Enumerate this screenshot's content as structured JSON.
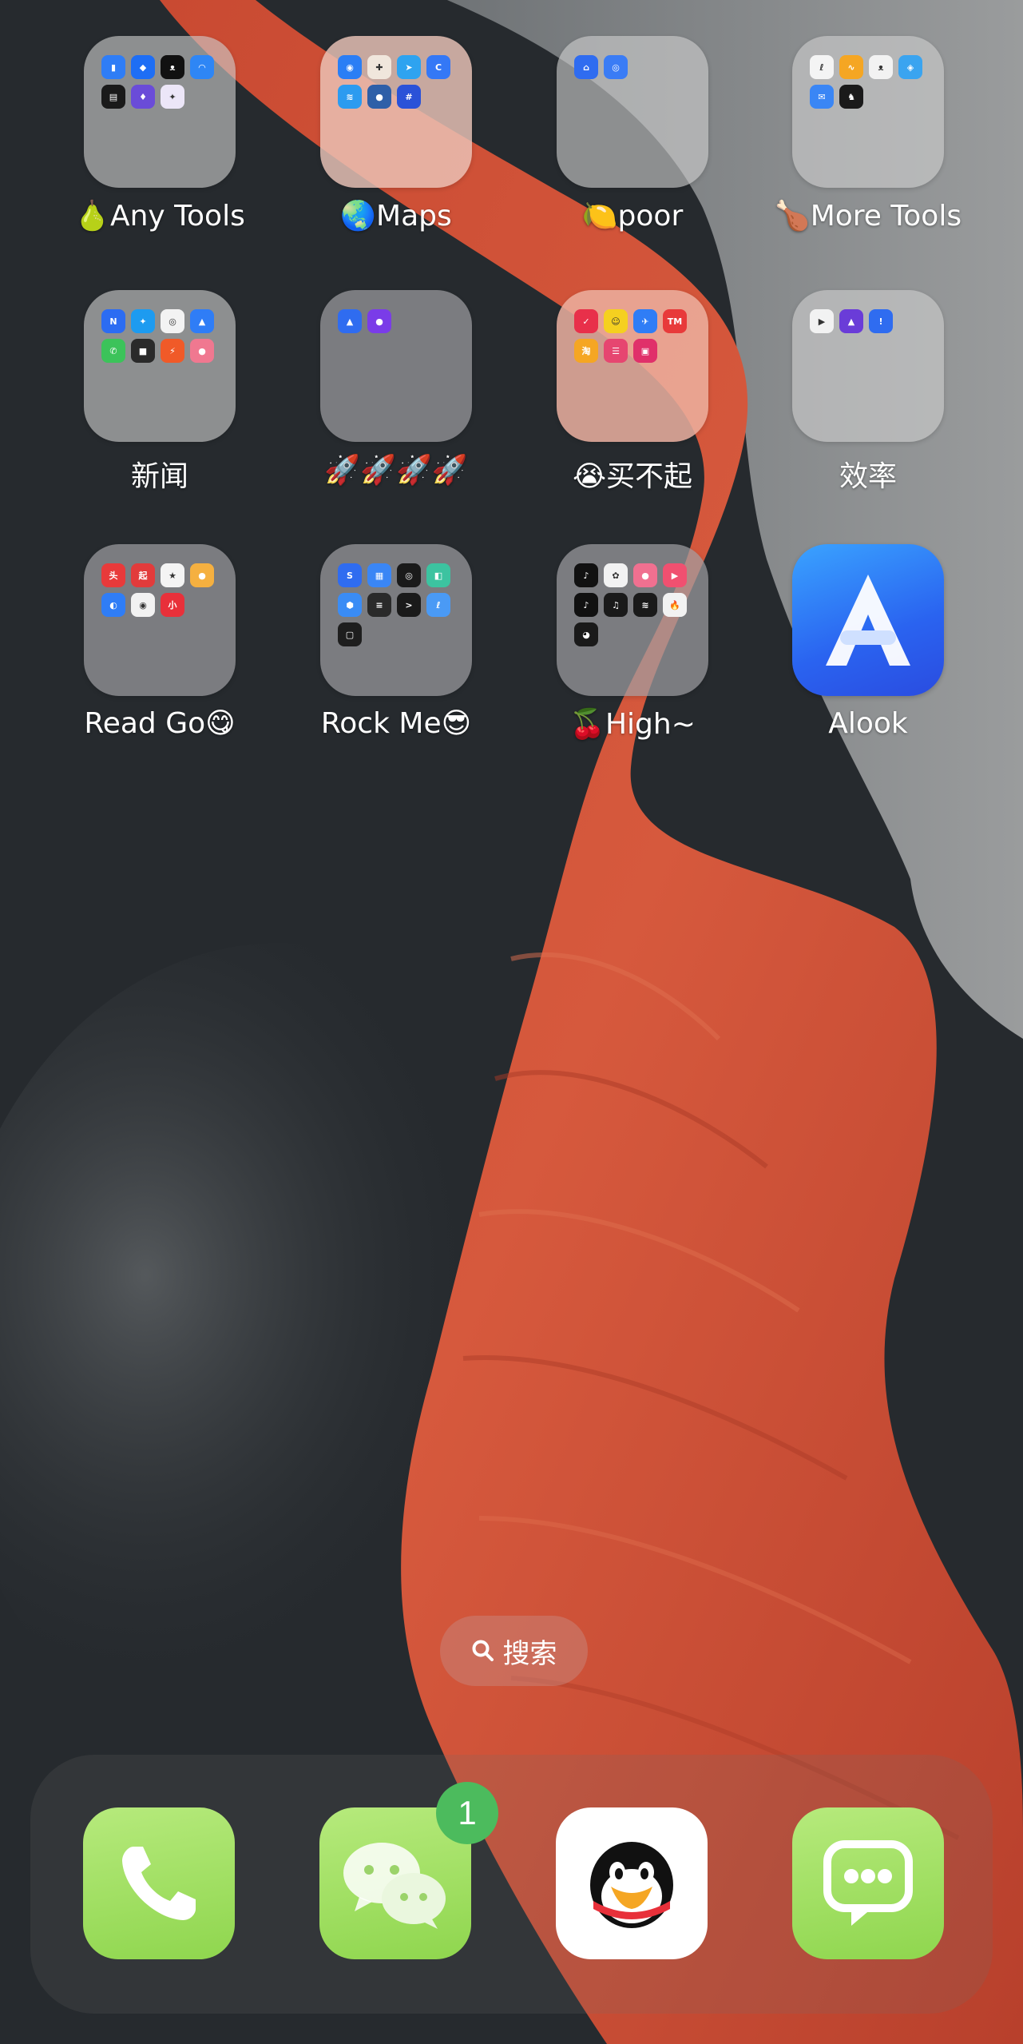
{
  "home_screen": {
    "folders": [
      {
        "label": "🍐Any Tools",
        "tint": "default",
        "mini_apps": [
          {
            "name": "stats-icon",
            "color": "#2f7df6",
            "glyph": "▮"
          },
          {
            "name": "app-icon",
            "color": "#1e6ef5",
            "glyph": "◆"
          },
          {
            "name": "cat-icon",
            "color": "#111111",
            "glyph": "ᴥ"
          },
          {
            "name": "network-icon",
            "color": "#2e86f5",
            "glyph": "◠"
          },
          {
            "name": "wallet-icon",
            "color": "#1a1a1a",
            "glyph": "▤"
          },
          {
            "name": "purple-app-icon",
            "color": "#6a4cd8",
            "glyph": "♦"
          },
          {
            "name": "rocket-icon",
            "color": "#ece6f8",
            "glyph": "✦"
          }
        ]
      },
      {
        "label": "🌏Maps",
        "tint": "peach",
        "mini_apps": [
          {
            "name": "gaode-map-icon",
            "color": "#2a7ef5",
            "glyph": "◉"
          },
          {
            "name": "apple-maps-icon",
            "color": "#f0e6dc",
            "glyph": "✚"
          },
          {
            "name": "telegram-icon",
            "color": "#2ea3f0",
            "glyph": "➤"
          },
          {
            "name": "baidu-map-icon",
            "color": "#3478f6",
            "glyph": "C"
          },
          {
            "name": "travel-icon",
            "color": "#2c9bf0",
            "glyph": "≋"
          },
          {
            "name": "earth-icon",
            "color": "#2e5fa8",
            "glyph": "●"
          },
          {
            "name": "subway-icon",
            "color": "#2a52d8",
            "glyph": "#"
          }
        ]
      },
      {
        "label": "🍋poor",
        "tint": "default",
        "mini_apps": [
          {
            "name": "finance-icon",
            "color": "#2f6cf0",
            "glyph": "⌂"
          },
          {
            "name": "bank-icon",
            "color": "#3a7cf5",
            "glyph": "◎"
          }
        ]
      },
      {
        "label": "🍗More Tools",
        "tint": "default",
        "mini_apps": [
          {
            "name": "telecom-icon",
            "color": "#f4f4f4",
            "glyph": "ℓ"
          },
          {
            "name": "weather-icon",
            "color": "#f5a623",
            "glyph": "∿"
          },
          {
            "name": "panda-icon",
            "color": "#f2f2f2",
            "glyph": "ᴥ"
          },
          {
            "name": "shield-icon",
            "color": "#3aa4f0",
            "glyph": "◈"
          },
          {
            "name": "mail-icon",
            "color": "#3a86f5",
            "glyph": "✉"
          },
          {
            "name": "dino-icon",
            "color": "#1a1a1a",
            "glyph": "♞"
          }
        ]
      },
      {
        "label": "新闻",
        "tint": "default",
        "mini_apps": [
          {
            "name": "news-n-icon",
            "color": "#2c6cf2",
            "glyph": "N"
          },
          {
            "name": "twitter-icon",
            "color": "#1d9bf0",
            "glyph": "✦"
          },
          {
            "name": "chrome-icon",
            "color": "#f3f3f3",
            "glyph": "◎"
          },
          {
            "name": "testflight-icon",
            "color": "#2f7df6",
            "glyph": "▲"
          },
          {
            "name": "whatsapp-icon",
            "color": "#3cc35a",
            "glyph": "✆"
          },
          {
            "name": "dark-app-icon",
            "color": "#2a2a2a",
            "glyph": "■"
          },
          {
            "name": "lightning-icon",
            "color": "#f05a28",
            "glyph": "⚡"
          },
          {
            "name": "pink-app-icon",
            "color": "#f07890",
            "glyph": "●"
          }
        ]
      },
      {
        "label": "🚀🚀🚀🚀",
        "tint": "gray",
        "mini_apps": [
          {
            "name": "shadowrocket-icon",
            "color": "#2f6cf0",
            "glyph": "▲"
          },
          {
            "name": "vpn-icon",
            "color": "#7a3ce8",
            "glyph": "●"
          }
        ]
      },
      {
        "label": "😭买不起",
        "tint": "pink",
        "mini_apps": [
          {
            "name": "pinduoduo-icon",
            "color": "#e8304a",
            "glyph": "✓"
          },
          {
            "name": "meituan-icon",
            "color": "#f5d020",
            "glyph": "☺"
          },
          {
            "name": "jd-icon",
            "color": "#2f7df6",
            "glyph": "✈"
          },
          {
            "name": "tmall-icon",
            "color": "#e83a3a",
            "glyph": "TM"
          },
          {
            "name": "taobao-icon",
            "color": "#f5a623",
            "glyph": "淘"
          },
          {
            "name": "xianyu-icon",
            "color": "#e64670",
            "glyph": "☰"
          },
          {
            "name": "shop-icon",
            "color": "#e0306a",
            "glyph": "▣"
          }
        ]
      },
      {
        "label": "效率",
        "tint": "default",
        "mini_apps": [
          {
            "name": "play-icon",
            "color": "#f2f2f2",
            "glyph": "▶"
          },
          {
            "name": "purple-tri-icon",
            "color": "#6a3cd8",
            "glyph": "▲"
          },
          {
            "name": "exclaim-icon",
            "color": "#2f6cf0",
            "glyph": "!"
          }
        ]
      },
      {
        "label": "Read Go😋",
        "tint": "gray",
        "mini_apps": [
          {
            "name": "toutiao-icon",
            "color": "#e83a3a",
            "glyph": "头"
          },
          {
            "name": "qidian-icon",
            "color": "#e23b3b",
            "glyph": "起"
          },
          {
            "name": "reading-icon",
            "color": "#f4f4f4",
            "glyph": "★"
          },
          {
            "name": "notes-icon",
            "color": "#f5b040",
            "glyph": "●"
          },
          {
            "name": "qq-browser-icon",
            "color": "#2f7df6",
            "glyph": "◐"
          },
          {
            "name": "weibo-icon",
            "color": "#f2f2f2",
            "glyph": "◉"
          },
          {
            "name": "xiaohongshu-icon",
            "color": "#e8303a",
            "glyph": "小"
          }
        ]
      },
      {
        "label": "Rock Me😎",
        "tint": "gray",
        "mini_apps": [
          {
            "name": "code-icon",
            "color": "#2f6cf0",
            "glyph": "S"
          },
          {
            "name": "files-icon",
            "color": "#3a86f5",
            "glyph": "▦"
          },
          {
            "name": "music-icon",
            "color": "#1a1a1a",
            "glyph": "◎"
          },
          {
            "name": "cube-icon",
            "color": "#3cc3a0",
            "glyph": "◧"
          },
          {
            "name": "settings-blue-icon",
            "color": "#3a8cf5",
            "glyph": "⬢"
          },
          {
            "name": "waveform-icon",
            "color": "#2a2a2a",
            "glyph": "≡"
          },
          {
            "name": "terminal-icon",
            "color": "#1a1a1a",
            "glyph": ">"
          },
          {
            "name": "script-icon",
            "color": "#4a9af5",
            "glyph": "ℓ"
          },
          {
            "name": "device-icon",
            "color": "#1e1e1e",
            "glyph": "▢"
          }
        ]
      },
      {
        "label": "🍒High~",
        "tint": "gray",
        "mini_apps": [
          {
            "name": "tiktok-icon",
            "color": "#111111",
            "glyph": "♪"
          },
          {
            "name": "panda-tv-icon",
            "color": "#f2f2f2",
            "glyph": "✿"
          },
          {
            "name": "pink-video-icon",
            "color": "#f07090",
            "glyph": "●"
          },
          {
            "name": "video-play-icon",
            "color": "#f05070",
            "glyph": "▶"
          },
          {
            "name": "douyin-icon",
            "color": "#111111",
            "glyph": "♪"
          },
          {
            "name": "green-music-icon",
            "color": "#1a1a1a",
            "glyph": "♫"
          },
          {
            "name": "spotify-icon",
            "color": "#1a1a1a",
            "glyph": "≋"
          },
          {
            "name": "fire-icon",
            "color": "#f2f2f2",
            "glyph": "🔥"
          },
          {
            "name": "live-icon",
            "color": "#1a1a1a",
            "glyph": "◕"
          }
        ]
      }
    ],
    "alook": {
      "label": "Alook"
    }
  },
  "search": {
    "label": "搜索"
  },
  "dock": {
    "phone": {
      "label": ""
    },
    "wechat": {
      "badge": "1"
    },
    "qq": {
      "label": ""
    },
    "messages": {
      "label": ""
    }
  },
  "colors": {
    "dock_green": "#8fd64e",
    "badge_green": "#4cbb5d",
    "alook_blue": "#2a63f0",
    "wallpaper_ribbon": "#d4553a",
    "wallpaper_dark": "#23272b"
  }
}
